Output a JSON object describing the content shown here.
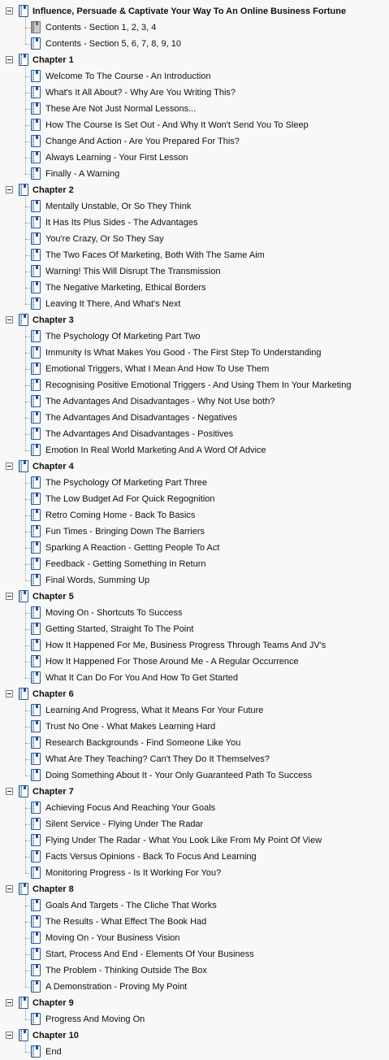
{
  "tree": [
    {
      "label": "Influence, Persuade & Captivate Your Way To An Online Business Fortune",
      "icon": "book-icon",
      "children": [
        {
          "label": "Contents - Section 1, 2, 3, 4",
          "icon": "book-gray-icon"
        },
        {
          "label": "Contents - Section 5, 6, 7, 8, 9, 10",
          "icon": "book-icon"
        }
      ]
    },
    {
      "label": "Chapter 1",
      "icon": "book-icon",
      "children": [
        {
          "label": "Welcome To The Course - An Introduction",
          "icon": "book-icon"
        },
        {
          "label": "What's It All About? - Why Are You Writing This?",
          "icon": "book-icon"
        },
        {
          "label": "These Are Not Just Normal Lessons...",
          "icon": "book-icon"
        },
        {
          "label": "How The Course Is Set Out - And Why It Won't Send You To Sleep",
          "icon": "book-icon"
        },
        {
          "label": "Change And Action - Are You Prepared For This?",
          "icon": "book-icon"
        },
        {
          "label": "Always Learning - Your First Lesson",
          "icon": "book-icon"
        },
        {
          "label": "Finally - A Warning",
          "icon": "book-icon"
        }
      ]
    },
    {
      "label": "Chapter 2",
      "icon": "book-icon",
      "children": [
        {
          "label": "Mentally Unstable, Or So They Think",
          "icon": "book-icon"
        },
        {
          "label": "It Has Its Plus Sides - The Advantages",
          "icon": "book-icon"
        },
        {
          "label": "You're Crazy, Or So They Say",
          "icon": "book-icon"
        },
        {
          "label": "The Two Faces Of Marketing, Both With The Same Aim",
          "icon": "book-icon"
        },
        {
          "label": "Warning! This Will Disrupt The Transmission",
          "icon": "book-icon"
        },
        {
          "label": "The Negative Marketing, Ethical Borders",
          "icon": "book-icon"
        },
        {
          "label": "Leaving It There, And What's Next",
          "icon": "book-icon"
        }
      ]
    },
    {
      "label": "Chapter 3",
      "icon": "book-icon",
      "children": [
        {
          "label": "The Psychology Of Marketing Part Two",
          "icon": "book-icon"
        },
        {
          "label": "Immunity Is What Makes You Good - The First Step To Understanding",
          "icon": "book-icon"
        },
        {
          "label": "Emotional Triggers, What I Mean And How To Use Them",
          "icon": "book-icon"
        },
        {
          "label": "Recognising Positive Emotional Triggers - And Using Them In Your Marketing",
          "icon": "book-icon"
        },
        {
          "label": "The Advantages And Disadvantages - Why Not Use both?",
          "icon": "book-icon"
        },
        {
          "label": "The Advantages And Disadvantages - Negatives",
          "icon": "book-icon"
        },
        {
          "label": "The Advantages And Disadvantages - Positives",
          "icon": "book-icon"
        },
        {
          "label": "Emotion In Real World Marketing And A Word Of Advice",
          "icon": "book-icon"
        }
      ]
    },
    {
      "label": "Chapter 4",
      "icon": "book-icon",
      "children": [
        {
          "label": "The Psychology Of Marketing Part Three",
          "icon": "book-icon"
        },
        {
          "label": "The Low Budget Ad For Quick Regognition",
          "icon": "book-icon"
        },
        {
          "label": "Retro Coming Home - Back To Basics",
          "icon": "book-icon"
        },
        {
          "label": "Fun Times - Bringing Down The Barriers",
          "icon": "book-icon"
        },
        {
          "label": "Sparking A Reaction - Getting People To Act",
          "icon": "book-icon"
        },
        {
          "label": "Feedback - Getting Something In Return",
          "icon": "book-icon"
        },
        {
          "label": "Final Words, Summing Up",
          "icon": "book-icon"
        }
      ]
    },
    {
      "label": "Chapter 5",
      "icon": "book-icon",
      "children": [
        {
          "label": "Moving On - Shortcuts To Success",
          "icon": "book-icon"
        },
        {
          "label": "Getting Started, Straight To The Point",
          "icon": "book-icon"
        },
        {
          "label": "How It Happened For Me, Business Progress Through Teams And JV's",
          "icon": "book-icon"
        },
        {
          "label": "How It Happened For Those Around Me - A Regular Occurrence",
          "icon": "book-icon"
        },
        {
          "label": "What It Can Do For You And How To Get Started",
          "icon": "book-icon"
        }
      ]
    },
    {
      "label": "Chapter 6",
      "icon": "book-icon",
      "children": [
        {
          "label": "Learning And Progress, What It Means For Your Future",
          "icon": "book-icon"
        },
        {
          "label": "Trust No One - What Makes Learning Hard",
          "icon": "book-icon"
        },
        {
          "label": "Research Backgrounds - Find Someone Like You",
          "icon": "book-icon"
        },
        {
          "label": "What Are They Teaching? Can't They Do It Themselves?",
          "icon": "book-icon"
        },
        {
          "label": "Doing Something About It - Your Only Guaranteed Path To Success",
          "icon": "book-icon"
        }
      ]
    },
    {
      "label": "Chapter 7",
      "icon": "book-icon",
      "children": [
        {
          "label": "Achieving Focus And Reaching Your Goals",
          "icon": "book-icon"
        },
        {
          "label": "Silent Service - Flying Under The Radar",
          "icon": "book-icon"
        },
        {
          "label": "Flying Under The Radar - What You Look Like From My Point Of View",
          "icon": "book-icon"
        },
        {
          "label": "Facts Versus Opinions - Back To Focus And Learning",
          "icon": "book-icon"
        },
        {
          "label": "Monitoring Progress - Is It Working For You?",
          "icon": "book-icon"
        }
      ]
    },
    {
      "label": "Chapter 8",
      "icon": "book-icon",
      "children": [
        {
          "label": "Goals And Targets - The Cliche That Works",
          "icon": "book-icon"
        },
        {
          "label": "The Results - What Effect The Book Had",
          "icon": "book-icon"
        },
        {
          "label": "Moving On - Your Business Vision",
          "icon": "book-icon"
        },
        {
          "label": "Start, Process And End - Elements Of Your Business",
          "icon": "book-icon"
        },
        {
          "label": "The Problem - Thinking Outside The Box",
          "icon": "book-icon"
        },
        {
          "label": "A Demonstration - Proving My Point",
          "icon": "book-icon"
        }
      ]
    },
    {
      "label": "Chapter 9",
      "icon": "book-icon",
      "children": [
        {
          "label": "Progress And Moving On",
          "icon": "book-icon"
        }
      ]
    },
    {
      "label": "Chapter 10",
      "icon": "book-icon",
      "children": [
        {
          "label": "End",
          "icon": "book-icon"
        }
      ]
    }
  ]
}
